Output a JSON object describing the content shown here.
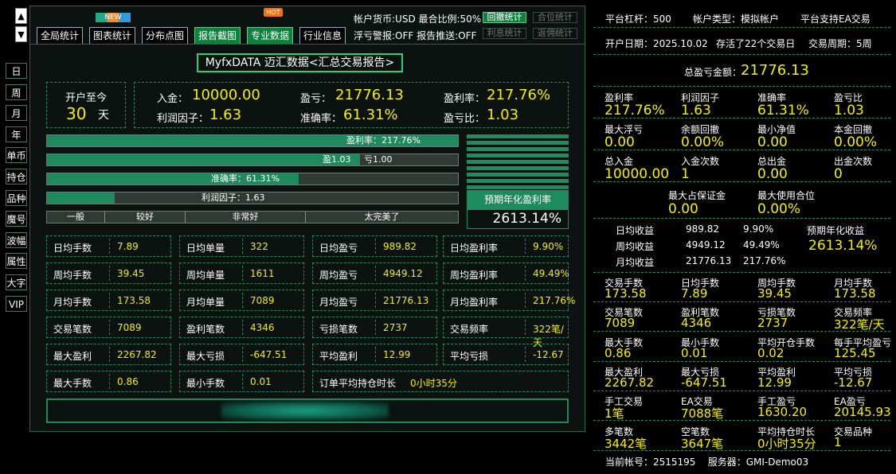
{
  "nav": {
    "up": "▲",
    "down": "▼",
    "side": [
      "日",
      "周",
      "月",
      "年",
      "单币",
      "持仓",
      "品种",
      "魔号",
      "波幅",
      "属性",
      "大字",
      "VIP"
    ]
  },
  "toolbar": {
    "buttons": [
      "全局统计",
      "图表统计",
      "分布点图",
      "报告截图",
      "专业数据",
      "行业信息"
    ],
    "new_badge": "NEW",
    "hot_badge": "HOT",
    "info_line1": "帐户货币:USD  最合比例:50%",
    "info_line2": "浮亏警报:OFF  报告推送:OFF",
    "small_btns": [
      "回撤统计",
      "合位统计",
      "利息统计",
      "返佣统计"
    ]
  },
  "title": "MyfxDATA 迈汇数据<汇总交易报告>",
  "since_open": {
    "label": "开户至今",
    "days": "30",
    "unit": "天"
  },
  "summary": {
    "deposit_label": "入金：",
    "deposit": "10000.00",
    "pnl_label": "盈亏：",
    "pnl": "21776.13",
    "roi_label": "盈利率：",
    "roi": "217.76%",
    "pf_label": "利润因子：",
    "pf": "1.63",
    "acc_label": "准确率：",
    "acc": "61.31%",
    "ratio_label": "盈亏比：",
    "ratio": "1.03"
  },
  "bars": {
    "roi_text": "盈利率：217.76%",
    "pl_win_text": "盈1.03",
    "pl_loss_text": "亏1.00",
    "acc_text": "准确率：61.31%",
    "pf_text": "利润因子：1.63",
    "rating": [
      "一般",
      "较好",
      "非常好",
      "太完美了"
    ],
    "acc_fraction": 0.6131,
    "pf_fraction": 0.165,
    "win_fraction": 0.5074
  },
  "annual": {
    "label": "预期年化盈利率",
    "value": "2613.14%"
  },
  "stats": [
    [
      [
        "日均手数",
        "7.89"
      ],
      [
        "日均单量",
        "322"
      ],
      [
        "日均盈亏",
        "989.82"
      ],
      [
        "日均盈利率",
        "9.90%"
      ]
    ],
    [
      [
        "周均手数",
        "39.45"
      ],
      [
        "周均单量",
        "1611"
      ],
      [
        "周均盈亏",
        "4949.12"
      ],
      [
        "周均盈利率",
        "49.49%"
      ]
    ],
    [
      [
        "月均手数",
        "173.58"
      ],
      [
        "月均单量",
        "7089"
      ],
      [
        "月均盈亏",
        "21776.13"
      ],
      [
        "月均盈利率",
        "217.76%"
      ]
    ],
    [
      [
        "交易笔数",
        "7089"
      ],
      [
        "盈利笔数",
        "4346"
      ],
      [
        "亏损笔数",
        "2737"
      ],
      [
        "交易频率",
        "322笔/天"
      ]
    ],
    [
      [
        "最大盈利",
        "2267.82"
      ],
      [
        "最大亏损",
        "-647.51"
      ],
      [
        "平均盈利",
        "12.99"
      ],
      [
        "平均亏损",
        "-12.67"
      ]
    ],
    [
      [
        "最大手数",
        "0.86"
      ],
      [
        "最小手数",
        "0.01"
      ],
      [
        "订单平均持仓时长",
        "0小时35分"
      ]
    ]
  ],
  "right": {
    "row1": [
      "平台杠杆：500",
      "帐户类型：模拟帐户",
      "平台支持EA交易"
    ],
    "row2": [
      "开户日期：2025.10.02",
      "存活了22个交易日",
      "交易周期：5周"
    ],
    "total_label": "总盈亏金额：",
    "total_value": "21776.13",
    "grid1": [
      [
        [
          "盈利率",
          "217.76%"
        ],
        [
          "利润因子",
          "1.63"
        ],
        [
          "准确率",
          "61.31%"
        ],
        [
          "盈亏比",
          "1.03"
        ]
      ],
      [
        [
          "最大浮亏",
          "0.00"
        ],
        [
          "余额回撤",
          "0.00%"
        ],
        [
          "最小净值",
          "0.00"
        ],
        [
          "本金回撤",
          "0.00%"
        ]
      ],
      [
        [
          "总入金",
          "10000.00"
        ],
        [
          "入金次数",
          "1"
        ],
        [
          "总出金",
          "0.00"
        ],
        [
          "出金次数",
          "0"
        ]
      ]
    ],
    "margin": [
      [
        "最大占保证金",
        "0.00"
      ],
      [
        "最大使用合位",
        "0.00%"
      ]
    ],
    "period": [
      [
        "日均收益",
        "989.82",
        "9.90%"
      ],
      [
        "周均收益",
        "4949.12",
        "49.49%"
      ],
      [
        "月均收益",
        "21776.13",
        "217.76%"
      ]
    ],
    "annual_label": "预期年化收益",
    "annual_value": "2613.14%",
    "grid2": [
      [
        [
          "交易手数",
          "173.58"
        ],
        [
          "日均手数",
          "7.89"
        ],
        [
          "周均手数",
          "39.45"
        ],
        [
          "月均手数",
          "173.58"
        ]
      ],
      [
        [
          "交易笔数",
          "7089"
        ],
        [
          "盈利笔数",
          "4346"
        ],
        [
          "亏损笔数",
          "2737"
        ],
        [
          "交易频率",
          "322笔/天"
        ]
      ],
      [
        [
          "最大手数",
          "0.86"
        ],
        [
          "最小手数",
          "0.01"
        ],
        [
          "平均开仓手数",
          "0.02"
        ],
        [
          "每手平均盈亏",
          "125.45"
        ]
      ],
      [
        [
          "最大盈利",
          "2267.82"
        ],
        [
          "最大亏损",
          "-647.51"
        ],
        [
          "平均盈利",
          "12.99"
        ],
        [
          "平均亏损",
          "-12.67"
        ]
      ],
      [
        [
          "手工交易",
          "1笔"
        ],
        [
          "EA交易",
          "7088笔"
        ],
        [
          "手工盈亏",
          "1630.20"
        ],
        [
          "EA盈亏",
          "20145.93"
        ]
      ],
      [
        [
          "多笔数",
          "3442笔"
        ],
        [
          "空笔数",
          "3647笔"
        ],
        [
          "平均持仓时长",
          "0小时35分"
        ],
        [
          "交易品种",
          "1"
        ]
      ]
    ],
    "footer": "当前帐号：2515195    服务器：GMI-Demo03"
  }
}
